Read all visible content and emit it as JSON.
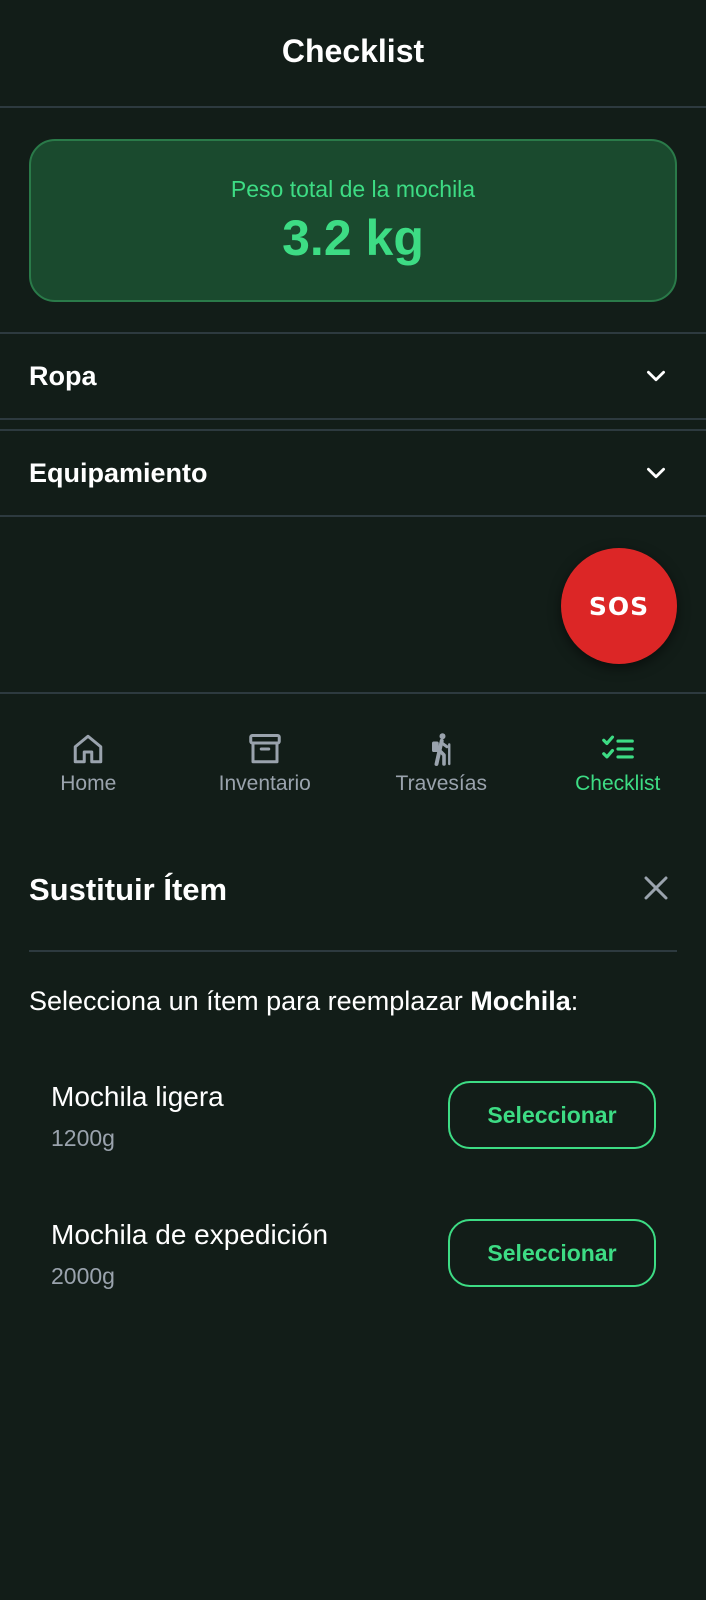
{
  "header": {
    "title": "Checklist"
  },
  "weight_card": {
    "label": "Peso total de la mochila",
    "value": "3.2 kg"
  },
  "sections": [
    {
      "label": "Ropa",
      "icon": "chevron-down-icon"
    },
    {
      "label": "Equipamiento",
      "icon": "chevron-down-icon"
    }
  ],
  "sos": {
    "label": "SOS",
    "color": "#dc2626"
  },
  "nav": {
    "items": [
      {
        "label": "Home",
        "icon": "home-icon"
      },
      {
        "label": "Inventario",
        "icon": "archive-icon"
      },
      {
        "label": "Travesías",
        "icon": "hiker-icon"
      },
      {
        "label": "Checklist",
        "icon": "checklist-icon",
        "active": true
      }
    ]
  },
  "modal": {
    "title": "Sustituir Ítem",
    "prompt_prefix": "Selecciona un ítem para reemplazar ",
    "prompt_item": "Mochila",
    "prompt_suffix": ":",
    "options": [
      {
        "name": "Mochila ligera",
        "weight": "1200g",
        "button_label": "Seleccionar"
      },
      {
        "name": "Mochila de expedición",
        "weight": "2000g",
        "button_label": "Seleccionar"
      }
    ]
  },
  "colors": {
    "accent": "#3ddc84",
    "background": "#121d18",
    "card": "#1a4a2e",
    "muted": "#9aa3ad"
  }
}
